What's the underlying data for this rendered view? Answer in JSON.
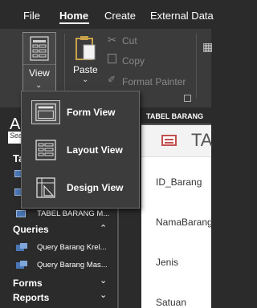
{
  "menu": {
    "items": [
      "File",
      "Home",
      "Create",
      "External Data"
    ],
    "active": "Home"
  },
  "ribbon": {
    "view_label": "View",
    "paste_label": "Paste",
    "cut_label": "Cut",
    "copy_label": "Copy",
    "format_painter_label": "Format Painter"
  },
  "view_menu": {
    "items": [
      {
        "label": "Form View",
        "icon": "form-view-icon",
        "selected": true
      },
      {
        "label": "Layout View",
        "icon": "layout-view-icon",
        "selected": false
      },
      {
        "label": "Design View",
        "icon": "design-view-icon",
        "selected": false
      }
    ]
  },
  "nav": {
    "title": "A",
    "search_placeholder": "Sea",
    "tables_header_partial": "Ta",
    "table_item": "TABEL BARANG M...",
    "queries_header": "Queries",
    "queries": [
      "Query Barang Krel...",
      "Query Barang Mas..."
    ],
    "forms_header": "Forms",
    "reports_header": "Reports"
  },
  "document": {
    "tab_label": "TABEL BARANG",
    "form_title": "TA",
    "fields": [
      "ID_Barang",
      "NamaBarang",
      "Jenis",
      "Satuan"
    ]
  },
  "colors": {
    "background": "#2b2b2b",
    "ribbon": "#3b3b3b",
    "accent_form_icon": "#c0504d",
    "table_icon": "#4a76b5"
  }
}
